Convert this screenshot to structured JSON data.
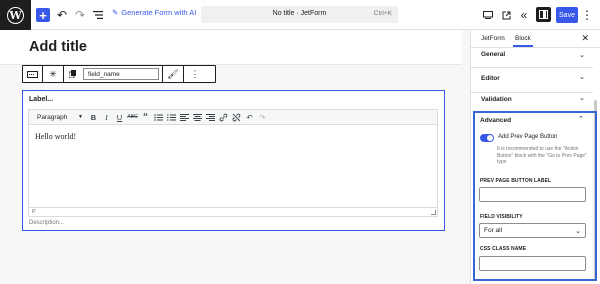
{
  "topbar": {
    "generate_label": "Generate Form with AI",
    "doc_title": "No title · JetForm",
    "shortcut": "Ctrl+K",
    "save_label": "Save"
  },
  "editor": {
    "title_placeholder": "Add title",
    "block_toolbar": {
      "field_name": "field_name"
    },
    "block": {
      "label": "Label...",
      "paragraph_select": "Paragraph",
      "content": "Hello world!",
      "status": "P",
      "description": "Description..."
    }
  },
  "sidebar": {
    "tabs": [
      "JetForm",
      "Block"
    ],
    "panels": [
      "General",
      "Editor",
      "Validation"
    ],
    "advanced": {
      "title": "Advanced",
      "toggle_label": "Add Prev Page Button",
      "toggle_on": true,
      "help": "It is recommended to use the \"Action Button\" block with the \"Go to Prev Page\" type",
      "prev_label": "PREV PAGE BUTTON LABEL",
      "prev_value": "",
      "visibility_label": "FIELD VISIBILITY",
      "visibility_value": "For all",
      "css_label": "CSS CLASS NAME",
      "css_value": ""
    }
  },
  "colors": {
    "accent": "#3858e9",
    "highlight_box": "#3866d6",
    "dark": "#1e1e1e"
  }
}
